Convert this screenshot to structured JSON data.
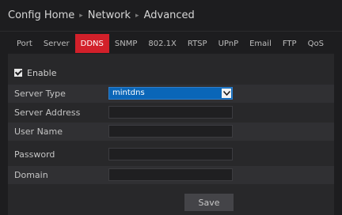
{
  "breadcrumb": {
    "items": [
      "Config Home",
      "Network",
      "Advanced"
    ],
    "separator": "▸"
  },
  "tabs": [
    {
      "label": "Port",
      "active": false
    },
    {
      "label": "Server",
      "active": false
    },
    {
      "label": "DDNS",
      "active": true
    },
    {
      "label": "SNMP",
      "active": false
    },
    {
      "label": "802.1X",
      "active": false
    },
    {
      "label": "RTSP",
      "active": false
    },
    {
      "label": "UPnP",
      "active": false
    },
    {
      "label": "Email",
      "active": false
    },
    {
      "label": "FTP",
      "active": false
    },
    {
      "label": "QoS",
      "active": false
    }
  ],
  "form": {
    "enable_label": "Enable",
    "enable_checked": true,
    "server_type_label": "Server Type",
    "server_type_value": "mintdns",
    "server_address_label": "Server Address",
    "server_address_value": "",
    "user_name_label": "User Name",
    "user_name_value": "",
    "password_label": "Password",
    "password_value": "",
    "domain_label": "Domain",
    "domain_value": ""
  },
  "actions": {
    "save_label": "Save"
  },
  "colors": {
    "active_tab": "#d2202a",
    "select_bg": "#0a66b8"
  }
}
